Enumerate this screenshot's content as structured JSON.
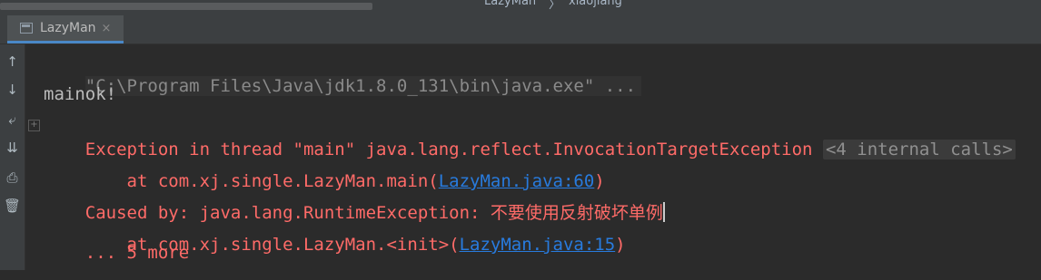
{
  "breadcrumb": {
    "project": "LazyMan",
    "separator": "〉",
    "author": "xiaojiang"
  },
  "tab": {
    "label": "LazyMan",
    "close": "×",
    "icon": "console-icon"
  },
  "sidebar": {
    "buttons": [
      {
        "name": "up-arrow-icon",
        "glyph": "↑"
      },
      {
        "name": "down-arrow-icon",
        "glyph": "↓"
      },
      {
        "name": "soft-wrap-icon",
        "glyph": "⤶"
      },
      {
        "name": "scroll-to-end-icon",
        "glyph": "⇊"
      },
      {
        "name": "print-icon",
        "glyph": "⎙"
      },
      {
        "name": "trash-icon",
        "glyph": "🗑"
      }
    ]
  },
  "console": {
    "command": "\"C:\\Program Files\\Java\\jdk1.8.0_131\\bin\\java.exe\" ...",
    "output1": "mainok!",
    "exception": "Exception in thread \"main\" java.lang.reflect.InvocationTargetException",
    "internal_calls": "<4 internal calls>",
    "at1_prefix": "    at com.xj.single.LazyMan.main(",
    "at1_link": "LazyMan.java:60",
    "at1_suffix": ")",
    "caused_by": "Caused by: java.lang.RuntimeException: 不要使用反射破坏单例",
    "at2_prefix": "    at com.xj.single.LazyMan.<init>(",
    "at2_link": "LazyMan.java:15",
    "at2_suffix": ")",
    "more": "    ... 5 more"
  },
  "colors": {
    "error": "#ff6b68",
    "link": "#287bde",
    "background": "#2b2b2b"
  }
}
